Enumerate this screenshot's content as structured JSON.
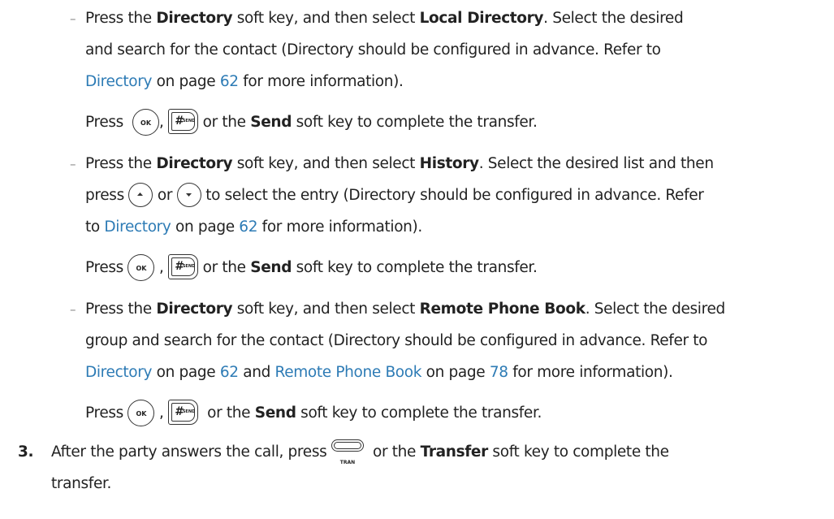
{
  "b1": {
    "dash": "–",
    "l1a": "Press the ",
    "l1b": "Directory",
    "l1c": " soft key, and then select ",
    "l1d": "Local Directory",
    "l1e": ". Select the desired",
    "l2": "and search for the contact (Directory should be configured in advance. Refer to",
    "l3link": "Directory",
    "l3b": " on page ",
    "l3page": "62",
    "l3c": " for more information).",
    "press": "Press",
    "comma": ",",
    "or": " or the ",
    "send": "Send",
    "tail": " soft key to complete the transfer."
  },
  "b2": {
    "dash": "–",
    "l1a": "Press the ",
    "l1b": "Directory",
    "l1c": " soft key, and then select ",
    "l1d": "History",
    "l1e": ". Select the desired list and then",
    "l2a": "press",
    "l2or": "or",
    "l2b": "to select the entry (Directory should be configured in advance. Refer",
    "l3a": "to ",
    "l3link": "Directory",
    "l3b": " on page ",
    "l3page": "62",
    "l3c": " for more information).",
    "press": "Press",
    "comma": ",",
    "or": " or the ",
    "send": "Send",
    "tail": " soft key to complete the transfer."
  },
  "b3": {
    "dash": "–",
    "l1a": "Press the ",
    "l1b": "Directory",
    "l1c": " soft key, and then select ",
    "l1d": "Remote Phone Book",
    "l1e": ". Select the desired",
    "l2": "group and search for the contact (Directory should be configured in advance. Refer to",
    "l3link": "Directory",
    "l3b": " on page ",
    "l3page": "62",
    "l3c": " and ",
    "l3link2": "Remote Phone Book",
    "l3d": " on page ",
    "l3page2": "78",
    "l3e": " for more information).",
    "press": "Press",
    "comma": ",",
    "or": " or the ",
    "send": "Send",
    "tail": " soft key to complete the transfer."
  },
  "step3": {
    "num": "3.",
    "a": "After the party answers the call, press",
    "b": " or the ",
    "transfer": "Transfer",
    "c": " soft key to complete the",
    "d": "transfer."
  },
  "keys": {
    "ok": "OK",
    "send_hash": "#",
    "send_sub": "SEND",
    "tran": "TRAN",
    "up_icon": "up-arrow-icon",
    "down_icon": "down-arrow-icon"
  },
  "colors": {
    "link": "#2d7bb5",
    "text": "#222222"
  }
}
